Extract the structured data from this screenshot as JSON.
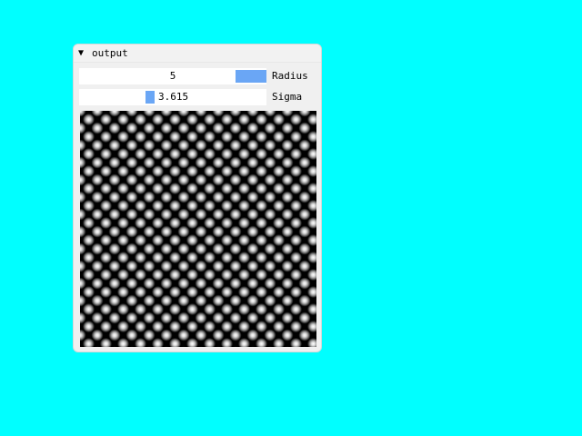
{
  "window": {
    "collapse_glyph": "▼",
    "title": "output"
  },
  "controls": {
    "radius": {
      "label": "Radius",
      "value": "5"
    },
    "sigma": {
      "label": "Sigma",
      "value": "3.615"
    }
  },
  "image": {
    "description_icon": "blurred-checkerboard-image"
  },
  "colors": {
    "background": "#00ffff",
    "slider_grab": "#6aa6f5",
    "panel": "#f0f0f0"
  }
}
